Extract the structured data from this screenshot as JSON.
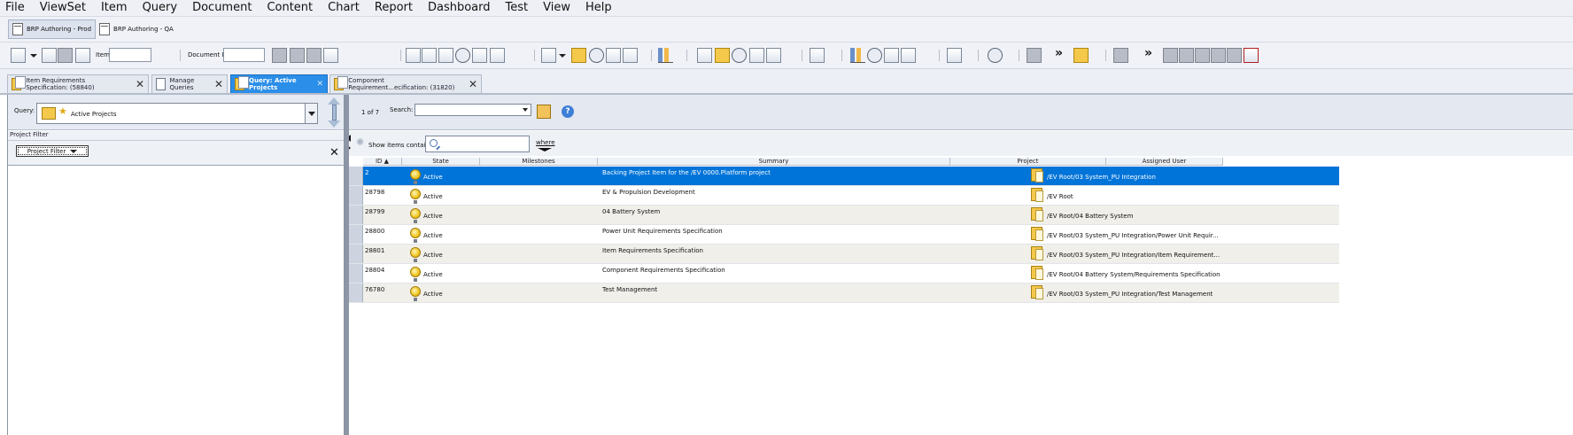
{
  "menu": [
    "File",
    "ViewSet",
    "Item",
    "Query",
    "Document",
    "Content",
    "Chart",
    "Report",
    "Dashboard",
    "Test",
    "View",
    "Help"
  ],
  "viewsets": [
    {
      "label": "BRP Authoring - Prod",
      "selected": true
    },
    {
      "label": "BRP Authoring - QA",
      "selected": false
    }
  ],
  "toolbar": {
    "item_label": "Item",
    "item_value": "",
    "document_id_label": "Document ID",
    "document_id_value": "",
    "more_glyph": "»"
  },
  "tabs": [
    {
      "label": "Item Requirements Specification:  (58840)",
      "active": false
    },
    {
      "label": "Manage Queries",
      "active": false
    },
    {
      "label": "Query: Active Projects",
      "active": true
    },
    {
      "label": "Component Requirement...ecification:  (31820)",
      "active": false
    }
  ],
  "query_panel": {
    "label": "Query:",
    "selected": "Active Projects"
  },
  "project_filter": {
    "header": "Project Filter",
    "button": "Project Filter"
  },
  "results": {
    "count": "1 of 7",
    "search_label": "Search:",
    "search_value": "",
    "filter_label": "Show items containing",
    "filter_value": "",
    "where_label": "where"
  },
  "grid": {
    "columns": [
      "ID",
      "State",
      "Milestones",
      "Summary",
      "Project",
      "Assigned User"
    ],
    "rows": [
      {
        "id": "2",
        "state": "Active",
        "milestones": "",
        "summary": "Backing Project Item for the /EV 0000.Platform project",
        "project": "/EV Root/03 System_PU Integration",
        "assigned": "",
        "selected": true
      },
      {
        "id": "28798",
        "state": "Active",
        "milestones": "",
        "summary": "EV & Propulsion Development",
        "project": "/EV Root",
        "assigned": "",
        "selected": false
      },
      {
        "id": "28799",
        "state": "Active",
        "milestones": "",
        "summary": "04 Battery System",
        "project": "/EV Root/04 Battery System",
        "assigned": "",
        "selected": false
      },
      {
        "id": "28800",
        "state": "Active",
        "milestones": "",
        "summary": "Power Unit Requirements Specification",
        "project": "/EV Root/03 System_PU Integration/Power Unit Requir...",
        "assigned": "",
        "selected": false
      },
      {
        "id": "28801",
        "state": "Active",
        "milestones": "",
        "summary": "Item Requirements Specification",
        "project": "/EV Root/03 System_PU Integration/Item Requirement...",
        "assigned": "",
        "selected": false
      },
      {
        "id": "28804",
        "state": "Active",
        "milestones": "",
        "summary": "Component Requirements Specification",
        "project": "/EV Root/04 Battery System/Requirements Specification",
        "assigned": "",
        "selected": false
      },
      {
        "id": "76780",
        "state": "Active",
        "milestones": "",
        "summary": "Test Management",
        "project": "/EV Root/03 System_PU Integration/Test Management",
        "assigned": "",
        "selected": false
      }
    ]
  },
  "colors": {
    "selection": "#0074d9",
    "active_tab": "#2b8ee8",
    "alt_row": "#f0efea"
  }
}
